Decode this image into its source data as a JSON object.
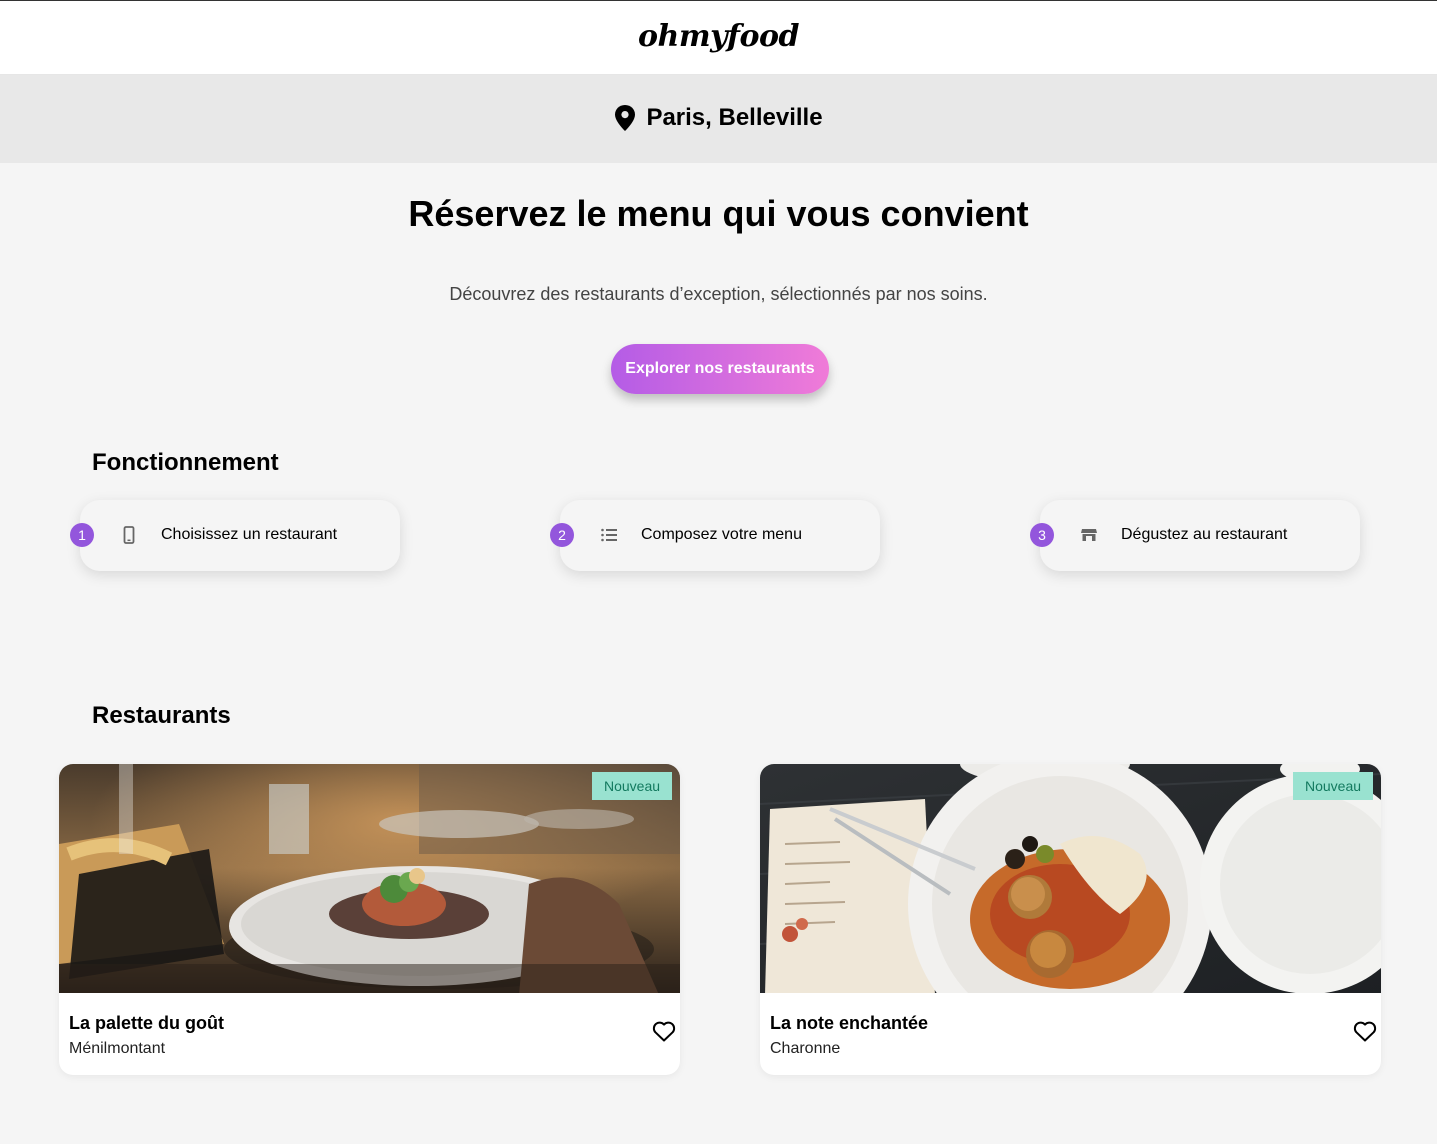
{
  "header": {
    "logo": "ohmyfood",
    "location": "Paris, Belleville",
    "location_icon": "map-pin-icon"
  },
  "hero": {
    "title": "Réservez le menu qui vous convient",
    "subtitle": "Découvrez des restaurants d’exception, sélectionnés par nos soins.",
    "cta_label": "Explorer nos restaurants"
  },
  "how_it_works": {
    "title": "Fonctionnement",
    "steps": [
      {
        "number": "1",
        "icon": "mobile-phone-icon",
        "label": "Choisissez un restaurant"
      },
      {
        "number": "2",
        "icon": "list-icon",
        "label": "Composez votre menu"
      },
      {
        "number": "3",
        "icon": "store-icon",
        "label": "Dégustez au restaurant"
      }
    ]
  },
  "restaurants": {
    "title": "Restaurants",
    "items": [
      {
        "badge": "Nouveau",
        "name": "La palette du goût",
        "area": "Ménilmontant",
        "favorite_icon": "heart-outline-icon"
      },
      {
        "badge": "Nouveau",
        "name": "La note enchantée",
        "area": "Charonne",
        "favorite_icon": "heart-outline-icon"
      }
    ]
  },
  "colors": {
    "accent": "#9356dc",
    "cta_start": "#b45ce6",
    "cta_end": "#f07bd8",
    "badge_bg": "#99e2d0",
    "badge_text": "#137a5f"
  }
}
